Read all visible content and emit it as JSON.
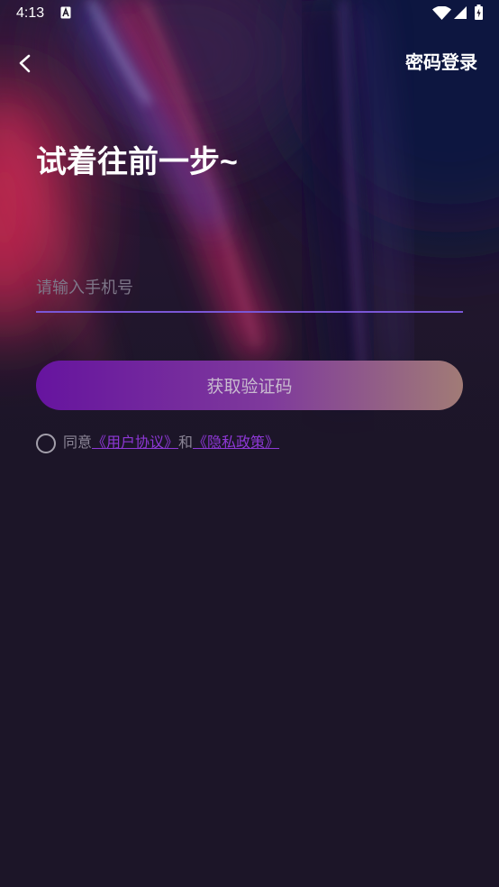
{
  "status_bar": {
    "time": "4:13",
    "icons": [
      "notification-icon",
      "wifi-icon",
      "signal-icon",
      "battery-charging-icon"
    ]
  },
  "header": {
    "back_icon": "chevron-left-icon",
    "password_login_label": "密码登录"
  },
  "title": "试着往前一步~",
  "phone_input": {
    "placeholder": "请输入手机号",
    "value": ""
  },
  "get_code_button": {
    "label": "获取验证码"
  },
  "agreement": {
    "checked": false,
    "agree_text": "同意",
    "user_agreement_link": "《用户协议》",
    "and_text": "和",
    "privacy_policy_link": "《隐私政策》"
  },
  "colors": {
    "background": "#1c1528",
    "underline": "#7a56d6",
    "link": "#8e38d6",
    "muted_text": "#8b8596",
    "button_start": "#66149f",
    "button_mid": "#7f3a9c",
    "button_end": "#a17b76",
    "button_text": "#c8b9cf"
  }
}
